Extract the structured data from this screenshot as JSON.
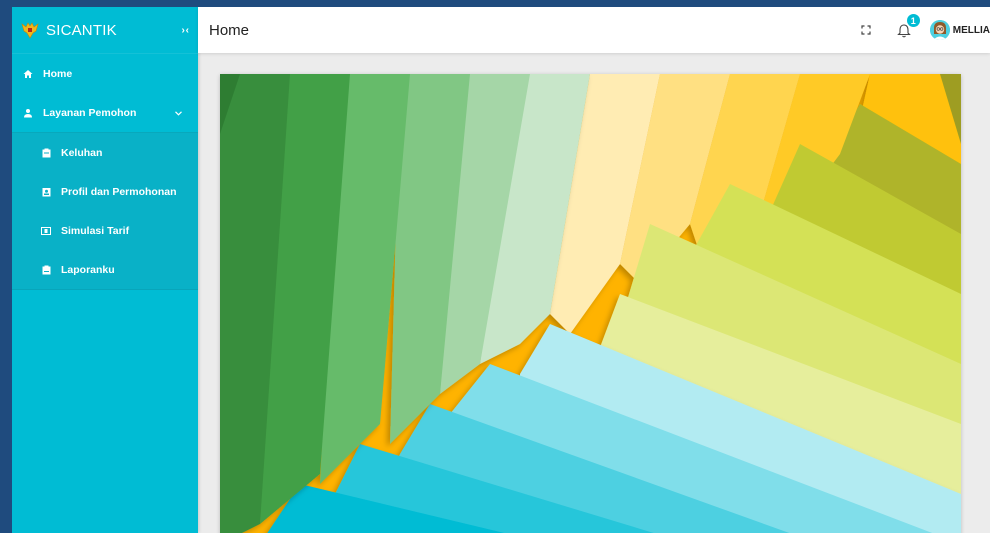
{
  "app": {
    "brand": "SICANTIK"
  },
  "sidebar": {
    "items": [
      {
        "label": "Home"
      },
      {
        "label": "Layanan Pemohon"
      }
    ],
    "submenu": [
      {
        "label": "Keluhan"
      },
      {
        "label": "Profil dan Permohonan"
      },
      {
        "label": "Simulasi Tarif"
      },
      {
        "label": "Laporanku"
      }
    ]
  },
  "header": {
    "title": "Home",
    "notification_count": "1",
    "user_name": "MELLIA"
  },
  "colors": {
    "sidebar": "#00bcd4",
    "accent": "#00bcd4",
    "background": "#1f4b7e"
  },
  "icons": {
    "brand": "garuda-logo-icon",
    "home": "home-icon",
    "users": "user-icon",
    "fullscreen": "fullscreen-icon",
    "bell": "bell-icon"
  }
}
